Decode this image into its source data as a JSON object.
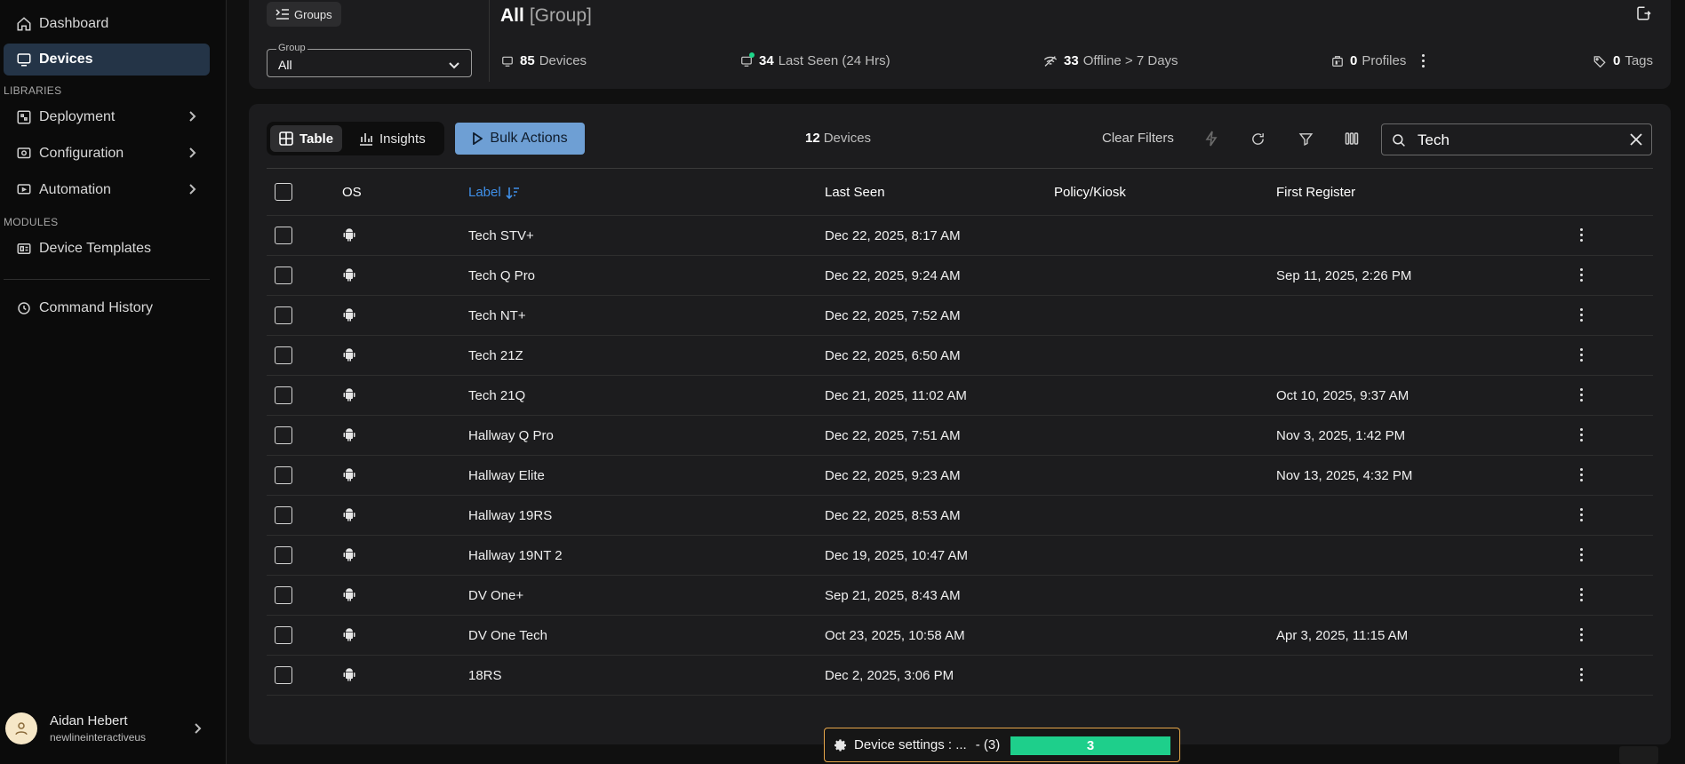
{
  "sidebar": {
    "items": [
      {
        "label": "Dashboard",
        "icon": "home-icon"
      },
      {
        "label": "Devices",
        "icon": "monitor-icon",
        "active": true
      }
    ],
    "sections": {
      "libraries": "LIBRARIES",
      "modules": "MODULES"
    },
    "library_items": [
      {
        "label": "Deployment",
        "icon": "deployment-icon"
      },
      {
        "label": "Configuration",
        "icon": "configuration-icon"
      },
      {
        "label": "Automation",
        "icon": "automation-icon"
      }
    ],
    "module_items": [
      {
        "label": "Device Templates",
        "icon": "template-icon"
      }
    ],
    "bottom_items": [
      {
        "label": "Command History",
        "icon": "history-icon"
      }
    ],
    "user": {
      "name": "Aidan Hebert",
      "org": "newlineinteractiveus"
    }
  },
  "header": {
    "groups_button": "Groups",
    "group_select": {
      "label": "Group",
      "value": "All"
    },
    "title": "All",
    "title_suffix": "[Group]",
    "stats": {
      "devices": {
        "count": "85",
        "label": "Devices"
      },
      "last_seen": {
        "count": "34",
        "label": "Last Seen (24 Hrs)"
      },
      "offline": {
        "count": "33",
        "label": "Offline > 7 Days"
      },
      "profiles": {
        "count": "0",
        "label": "Profiles"
      },
      "tags": {
        "count": "0",
        "label": "Tags"
      }
    }
  },
  "toolbar": {
    "view_table": "Table",
    "view_insights": "Insights",
    "bulk_actions": "Bulk Actions",
    "device_count": "12",
    "device_count_label": "Devices",
    "clear_filters": "Clear Filters",
    "search_value": "Tech"
  },
  "table": {
    "columns": {
      "os": "OS",
      "label": "Label",
      "last_seen": "Last Seen",
      "policy": "Policy/Kiosk",
      "first_register": "First Register"
    },
    "rows": [
      {
        "label": "Tech STV+",
        "last_seen": "Dec 22, 2025, 8:17 AM",
        "policy": "",
        "first_register": ""
      },
      {
        "label": "Tech Q Pro",
        "last_seen": "Dec 22, 2025, 9:24 AM",
        "policy": "",
        "first_register": "Sep 11, 2025, 2:26 PM"
      },
      {
        "label": "Tech NT+",
        "last_seen": "Dec 22, 2025, 7:52 AM",
        "policy": "",
        "first_register": ""
      },
      {
        "label": "Tech 21Z",
        "last_seen": "Dec 22, 2025, 6:50 AM",
        "policy": "",
        "first_register": ""
      },
      {
        "label": "Tech 21Q",
        "last_seen": "Dec 21, 2025, 11:02 AM",
        "policy": "",
        "first_register": "Oct 10, 2025, 9:37 AM"
      },
      {
        "label": "Hallway Q Pro",
        "last_seen": "Dec 22, 2025, 7:51 AM",
        "policy": "",
        "first_register": "Nov 3, 2025, 1:42 PM"
      },
      {
        "label": "Hallway Elite",
        "last_seen": "Dec 22, 2025, 9:23 AM",
        "policy": "",
        "first_register": "Nov 13, 2025, 4:32 PM"
      },
      {
        "label": "Hallway 19RS",
        "last_seen": "Dec 22, 2025, 8:53 AM",
        "policy": "",
        "first_register": ""
      },
      {
        "label": "Hallway 19NT 2",
        "last_seen": "Dec 19, 2025, 10:47 AM",
        "policy": "",
        "first_register": ""
      },
      {
        "label": "DV One+",
        "last_seen": "Sep 21, 2025, 8:43 AM",
        "policy": "",
        "first_register": ""
      },
      {
        "label": "DV One Tech",
        "last_seen": "Oct 23, 2025, 10:58 AM",
        "policy": "",
        "first_register": "Apr 3, 2025, 11:15 AM"
      },
      {
        "label": "18RS",
        "last_seen": "Dec 2, 2025, 3:06 PM",
        "policy": "",
        "first_register": ""
      }
    ]
  },
  "toast": {
    "text": "Device settings : ...",
    "count": "- (3)",
    "progress_label": "3",
    "progress_fraction": 1.0
  },
  "colors": {
    "accent": "#6e9fd4",
    "active_nav": "#243447",
    "link": "#3f8fe8",
    "success": "#1ecf8b",
    "toast_border": "#e8a74a"
  }
}
